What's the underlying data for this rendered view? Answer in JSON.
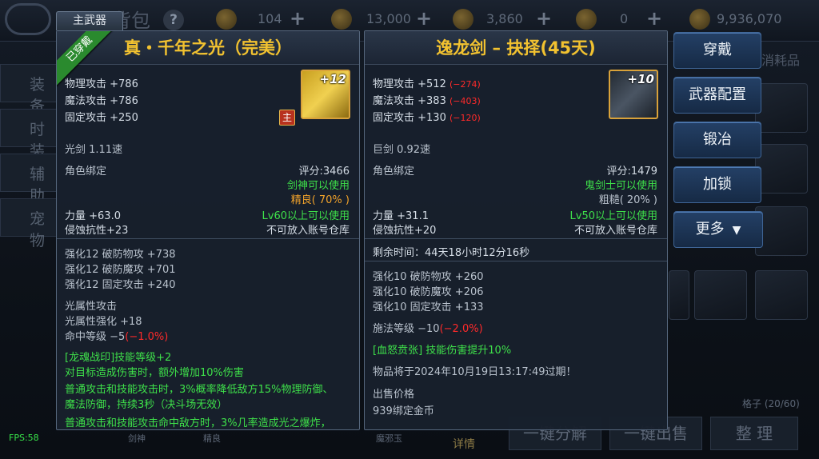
{
  "top_bar": {
    "title": "背包",
    "help_icon": "?",
    "currencies": [
      {
        "icon": "coin-icon",
        "value": "104"
      },
      {
        "icon": "scroll-icon",
        "value": "13,000"
      },
      {
        "icon": "ticket-icon",
        "value": "3,860"
      },
      {
        "icon": "gem-icon",
        "value": "0"
      },
      {
        "icon": "gold-icon",
        "value": "9,936,070"
      }
    ]
  },
  "left_tabs": [
    "装备",
    "时装",
    "辅助",
    "宠物"
  ],
  "right_tab": "消耗品",
  "bag_count": "格子 (20/60)",
  "bottom_buttons": [
    "一键分解",
    "一键出售",
    "整 理"
  ],
  "detail_label": "详情",
  "bottom_slot_captions": [
    "剑神",
    "精良",
    "魔邪玉"
  ],
  "fps": "FPS:58",
  "left_panel": {
    "tab_label": "主武器",
    "equipped_ribbon": "已穿戴",
    "title": "真・千年之光（完美）",
    "icon_enhance": "+12",
    "main_badge": "主",
    "stats": [
      "物理攻击 +786",
      "魔法攻击 +786",
      "固定攻击 +250"
    ],
    "speed": "光剑 1.11速",
    "binding": "角色绑定",
    "score": "评分:3466",
    "class_req": "剑神可以使用",
    "quality": "精良( 70% )",
    "strength": "力量 +63.0",
    "level_req": "Lv60以上可以使用",
    "erosion": "侵蚀抗性+23",
    "storage": "不可放入账号仓库",
    "enhance": [
      "强化12 破防物攻 +738",
      "强化12 破防魔攻 +701",
      "强化12 固定攻击 +240"
    ],
    "element_title": "光属性攻击",
    "element_strength": "光属性强化 +18",
    "hit_rank": "命中等级 −5",
    "hit_rank_delta": "(−1.0%)",
    "skill_title": "[龙魂战印]技能等级+2",
    "effects": [
      "对目标造成伤害时，额外增加10%伤害",
      "普通攻击和技能攻击时，3%概率降低敌方15%物理防御、",
      "魔法防御，持续3秒（决斗场无效）",
      "普通攻击和技能攻击命中敌方时，3%几率造成光之爆炸，"
    ]
  },
  "right_panel": {
    "title": "逸龙剑 – 抉择(45天)",
    "icon_enhance": "+10",
    "stats": [
      {
        "text": "物理攻击 +512",
        "delta": "(−274)"
      },
      {
        "text": "魔法攻击 +383",
        "delta": "(−403)"
      },
      {
        "text": "固定攻击 +130",
        "delta": "(−120)"
      }
    ],
    "speed": "巨剑 0.92速",
    "binding": "角色绑定",
    "score": "评分:1479",
    "class_req": "鬼剑士可以使用",
    "quality": "粗糙( 20% )",
    "strength": "力量 +31.1",
    "level_req": "Lv50以上可以使用",
    "erosion": "侵蚀抗性+20",
    "storage": "不可放入账号仓库",
    "remaining": "剩余时间：44天18小时12分16秒",
    "enhance": [
      "强化10 破防物攻 +260",
      "强化10 破防魔攻 +206",
      "强化10 固定攻击 +133"
    ],
    "cast_level": "施法等级 −10",
    "cast_level_delta": "(−2.0%)",
    "skill_bonus": "[血怒贲张] 技能伤害提升10%",
    "expiry": "物品将于2024年10月19日13:17:49过期！",
    "sell_title": "出售价格",
    "sell_price": "939绑定金币"
  },
  "action_buttons": [
    "穿戴",
    "武器配置",
    "锻冶",
    "加锁",
    "更多"
  ],
  "colors": {
    "title_gold": "#f2c230",
    "green": "#3ee04a",
    "red": "#ff2a2a",
    "orange": "#f0a22a",
    "button_blue": "#244066"
  }
}
